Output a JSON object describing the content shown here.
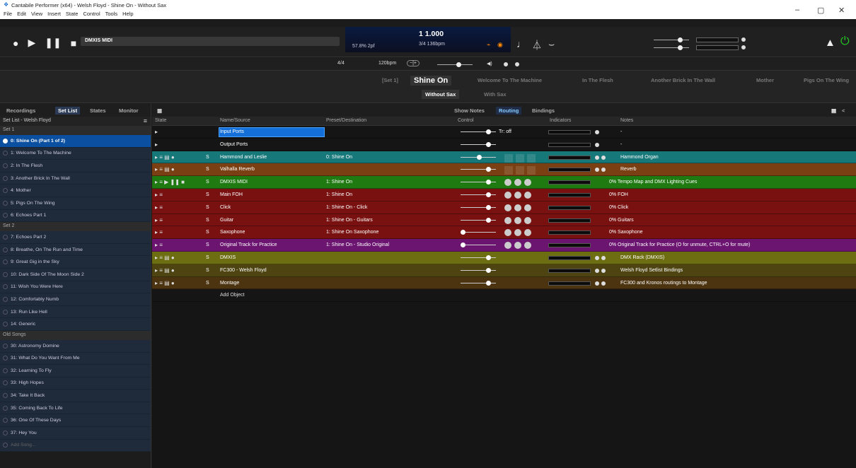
{
  "window": {
    "title": "Cantabile Performer (x64) - Welsh Floyd - Shine On - Without Sax",
    "minimize": "–",
    "maximize": "▢",
    "close": "✕"
  },
  "menu": [
    "File",
    "Edit",
    "View",
    "Insert",
    "State",
    "Control",
    "Tools",
    "Help"
  ],
  "transport": {
    "song_bar": "DMXIS MIDI",
    "lcd_position": "1 1.000",
    "lcd_timesig": "3/4 136bpm",
    "lcd_load": "57.8% 2pf"
  },
  "row2": {
    "timesig": "4/4",
    "tempo": "120bpm"
  },
  "songs": {
    "prefix": "[Set 1]",
    "current": "Shine On",
    "items": [
      "Welcome To The Machine",
      "In The Flesh",
      "Another Brick In The Wall",
      "Mother",
      "Pigs On The Wing"
    ],
    "states": [
      "Without Sax",
      "With Sax"
    ]
  },
  "left_tabs": [
    "Recordings",
    "Set List",
    "States",
    "Monitor"
  ],
  "setlist": {
    "header": "Set List - Welsh Floyd",
    "groups": [
      {
        "name": "Set 1",
        "items": [
          "0: Shine On (Part 1 of 2)",
          "1: Welcome To The Machine",
          "2: In The Flesh",
          "3: Another Brick In The Wall",
          "4: Mother",
          "5: Pigs On The Wing",
          "6: Echoes Part 1"
        ]
      },
      {
        "name": "Set 2",
        "items": [
          "7: Echoes Part 2",
          "8: Breathe, On The Run and Time",
          "9: Great Gig in the Sky",
          "10: Dark Side Of The Moon Side 2",
          "11: Wish You Were Here",
          "12: Comfortably Numb",
          "13: Run Like Hell",
          "14: Generic"
        ]
      },
      {
        "name": "Old Songs",
        "items": [
          "30: Astronomy Domine",
          "31: What Do You Want From Me",
          "32: Learning To Fly",
          "33: High Hopes",
          "34: Take It Back",
          "35: Coming Back To Life",
          "36: One Of These Days",
          "37: Hey You"
        ]
      }
    ],
    "add_song": "Add Song..."
  },
  "main_tabs": [
    "Show Notes",
    "Routing",
    "Bindings"
  ],
  "columns": [
    "State",
    "Name/Source",
    "Preset/Destination",
    "Control",
    "Indicators",
    "Notes"
  ],
  "rows": [
    {
      "name": "Input Ports",
      "preset": "",
      "ctrl": "Tr: off",
      "note": "-",
      "color": "#151515",
      "pos": 0.78,
      "knobs": false,
      "dots": 1
    },
    {
      "name": "Output Ports",
      "preset": "",
      "ctrl": "",
      "note": "-",
      "color": "#151515",
      "pos": 0.78,
      "knobs": false,
      "dots": 1
    },
    {
      "name": "Hammond and Leslie",
      "preset": "0: Shine On",
      "ctrl": "",
      "note": "Hammond Organ",
      "color": "#17787a",
      "pos": 0.5,
      "knobs": "boxes",
      "dots": 2
    },
    {
      "name": "Valhalla Reverb",
      "preset": "",
      "ctrl": "",
      "note": "Reverb",
      "color": "#7a3f12",
      "pos": 0.78,
      "knobs": "boxes",
      "dots": 2
    },
    {
      "name": "DMXIS MIDI",
      "preset": "1: Shine On",
      "ctrl": "",
      "note": "0% Tempo Map and DMX Lighting Cues",
      "color": "#1f7a12",
      "pos": 0.78,
      "knobs": true,
      "dots": 0
    },
    {
      "name": "Main FOH",
      "preset": "1: Shine On",
      "ctrl": "",
      "note": "0% FOH",
      "color": "#7a1111",
      "pos": 0.78,
      "knobs": true,
      "dots": 0
    },
    {
      "name": "Click",
      "preset": "1: Shine On - Click",
      "ctrl": "",
      "note": "0% Click",
      "color": "#7a1111",
      "pos": 0.78,
      "knobs": true,
      "dots": 0
    },
    {
      "name": "Guitar",
      "preset": "1: Shine On - Guitars",
      "ctrl": "",
      "note": "0% Guitars",
      "color": "#7a1111",
      "pos": 0.78,
      "knobs": true,
      "dots": 0
    },
    {
      "name": "Saxophone",
      "preset": "1: Shine On Saxophone",
      "ctrl": "",
      "note": "0% Saxophone",
      "color": "#7a1111",
      "pos": 0.0,
      "knobs": true,
      "dots": 0
    },
    {
      "name": "Original Track for Practice",
      "preset": "1: Shine On - Studio Original",
      "ctrl": "",
      "note": "0% Original Track for Practice (O for unmute, CTRL+O for mute)",
      "color": "#6b1470",
      "pos": 0.0,
      "knobs": true,
      "dots": 0
    },
    {
      "name": "DMXIS",
      "preset": "",
      "ctrl": "",
      "note": "DMX Rack (DMXIS)",
      "color": "#6d6d12",
      "pos": 0.78,
      "knobs": false,
      "dots": 2
    },
    {
      "name": "FC300 - Welsh Floyd",
      "preset": "",
      "ctrl": "",
      "note": "Welsh Floyd Setlist Bindings",
      "color": "#4d4412",
      "pos": 0.78,
      "knobs": false,
      "dots": 2
    },
    {
      "name": "Montage",
      "preset": "",
      "ctrl": "",
      "note": "FC300 and Kronos routings to Montage",
      "color": "#4d3410",
      "pos": 0.78,
      "knobs": false,
      "dots": 2
    }
  ],
  "add_object": "Add Object"
}
